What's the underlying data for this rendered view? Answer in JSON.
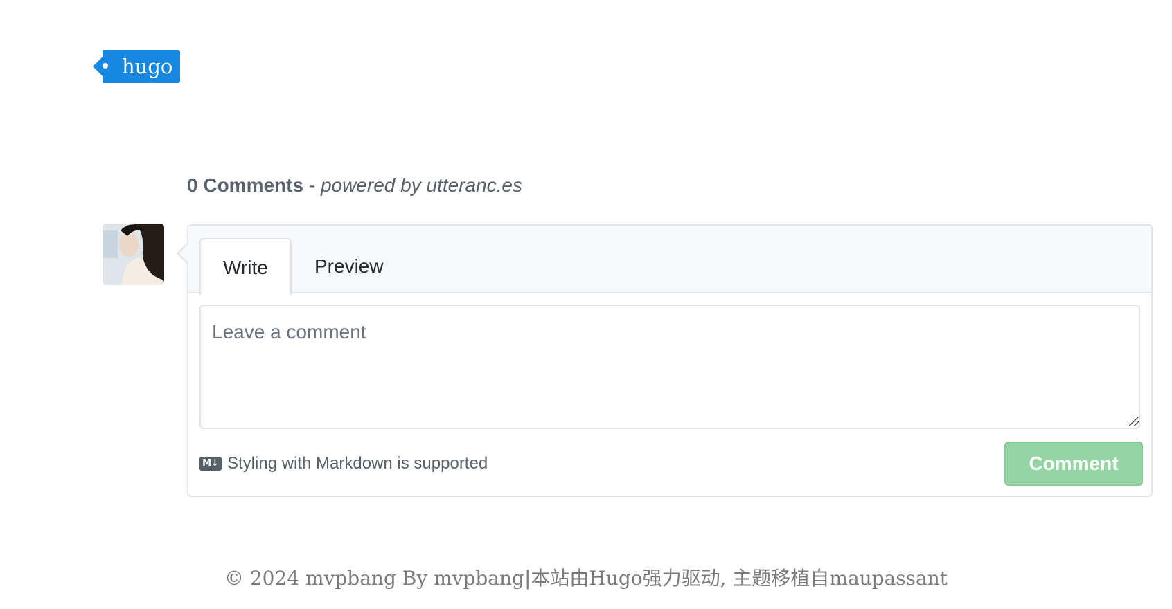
{
  "tag": {
    "label": "hugo"
  },
  "comments": {
    "count_label": "0 Comments",
    "separator": " - ",
    "powered_label": "powered by utteranc.es"
  },
  "editor": {
    "tab_write": "Write",
    "tab_preview": "Preview",
    "placeholder": "Leave a comment",
    "markdown_icon": "M↓",
    "markdown_note": "Styling with Markdown is supported",
    "submit_label": "Comment"
  },
  "footer": {
    "text": "© 2024 mvpbang By mvpbang|本站由Hugo强力驱动, 主题移植自maupassant"
  },
  "colors": {
    "tag_bg": "#1787e0",
    "button_bg": "#94d3a2",
    "border": "#dfe3e8"
  }
}
